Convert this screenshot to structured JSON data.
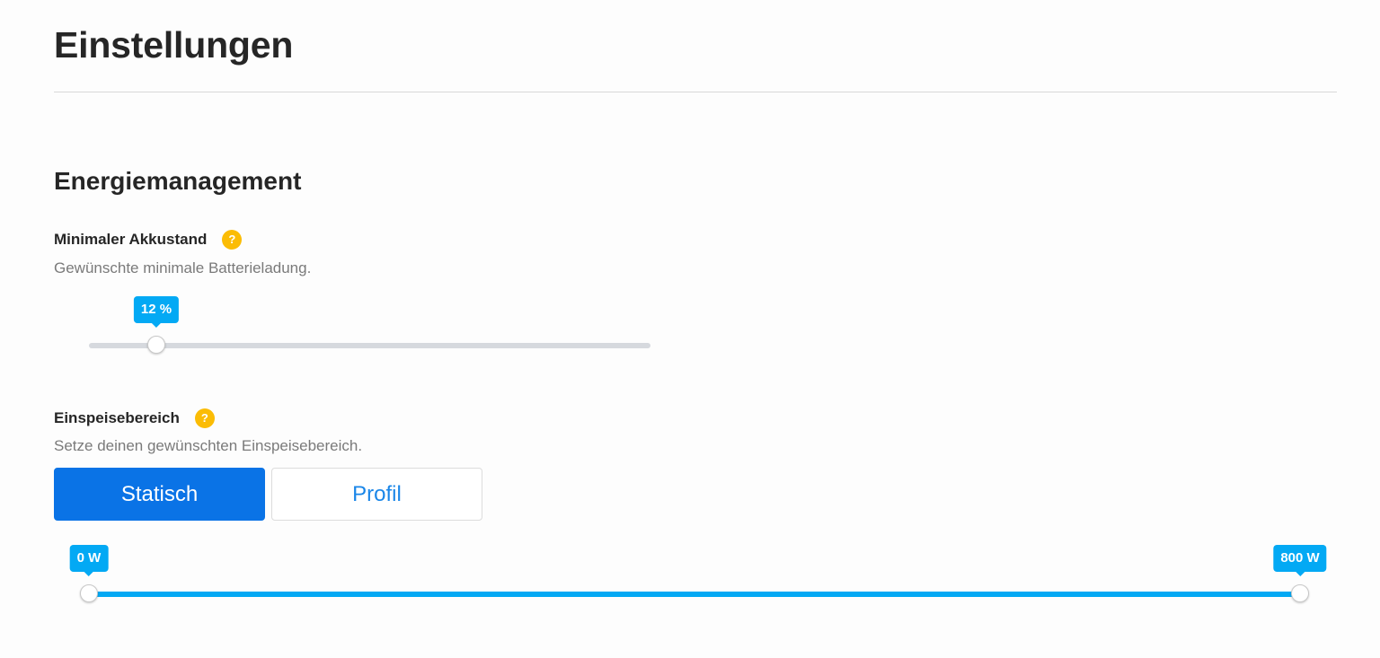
{
  "page": {
    "title": "Einstellungen"
  },
  "section": {
    "title": "Energiemanagement"
  },
  "min_battery": {
    "label": "Minimaler Akkustand",
    "help_icon": "?",
    "description": "Gewünschte minimale Batterieladung.",
    "value": 12,
    "min": 0,
    "max": 100,
    "value_label": "12 %"
  },
  "feed_in": {
    "label": "Einspeisebereich",
    "help_icon": "?",
    "description": "Setze deinen gewünschten Einspeisebereich.",
    "modes": [
      "Statisch",
      "Profil"
    ],
    "active_mode": "Statisch",
    "range_min": 0,
    "range_max": 800,
    "low_value": 0,
    "high_value": 800,
    "low_label": "0 W",
    "high_label": "800 W"
  },
  "colors": {
    "accent": "#03a9f4",
    "primary_button": "#0a73e6",
    "help_icon": "#fbbc05"
  }
}
